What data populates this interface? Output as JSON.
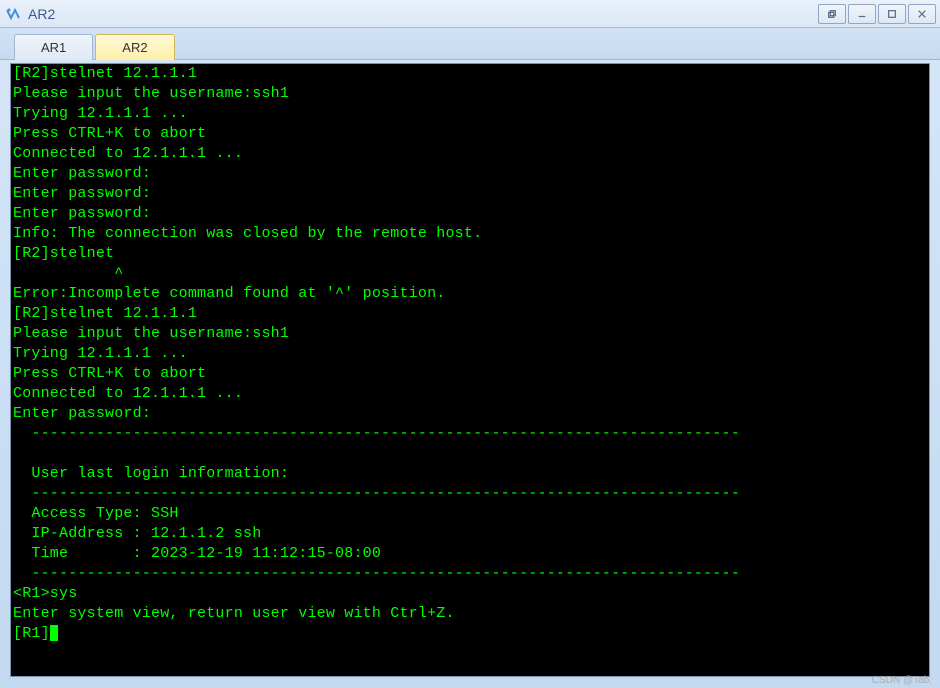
{
  "window": {
    "title": "AR2"
  },
  "tabs": [
    {
      "label": "AR1",
      "active": false
    },
    {
      "label": "AR2",
      "active": true
    }
  ],
  "terminal": {
    "lines": [
      "[R2]stelnet 12.1.1.1",
      "Please input the username:ssh1",
      "Trying 12.1.1.1 ...",
      "Press CTRL+K to abort",
      "Connected to 12.1.1.1 ...",
      "Enter password:",
      "Enter password:",
      "Enter password:",
      "Info: The connection was closed by the remote host.",
      "[R2]stelnet",
      "           ^",
      "Error:Incomplete command found at '^' position.",
      "[R2]stelnet 12.1.1.1",
      "Please input the username:ssh1",
      "Trying 12.1.1.1 ...",
      "Press CTRL+K to abort",
      "Connected to 12.1.1.1 ...",
      "Enter password:",
      "  -----------------------------------------------------------------------------",
      "",
      "  User last login information:",
      "  -----------------------------------------------------------------------------",
      "  Access Type: SSH",
      "  IP-Address : 12.1.1.2 ssh",
      "  Time       : 2023-12-19 11:12:15-08:00",
      "  -----------------------------------------------------------------------------",
      "<R1>sys",
      "Enter system view, return user view with Ctrl+Z.",
      "[R1]"
    ]
  },
  "watermark": "CSDN @Tab."
}
